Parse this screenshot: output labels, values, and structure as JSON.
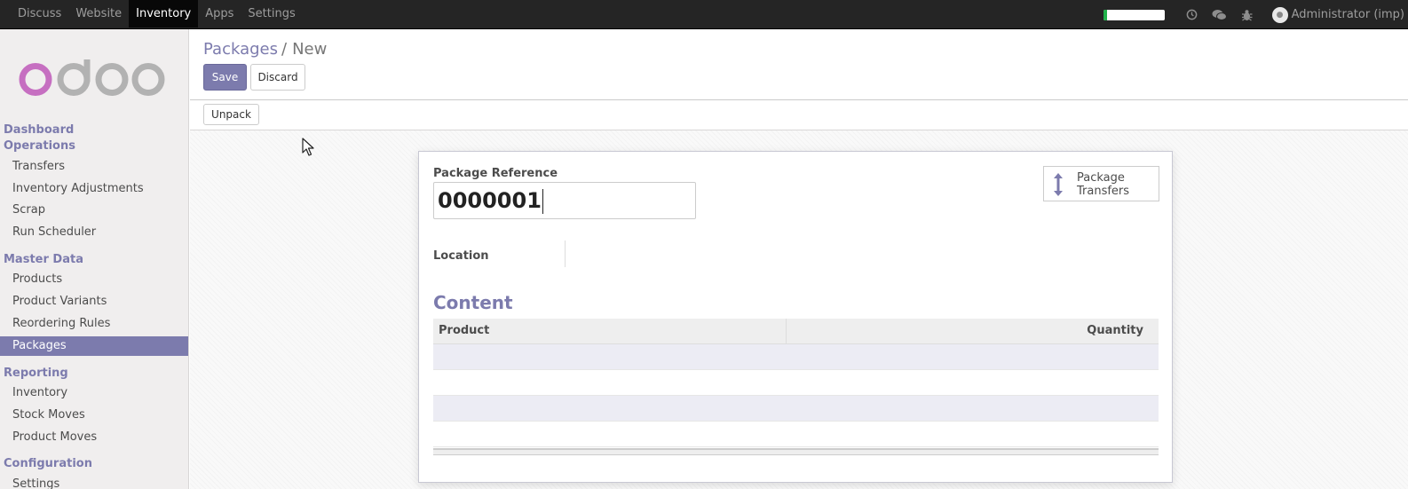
{
  "topbar": {
    "menu": [
      {
        "label": "Discuss",
        "active": false
      },
      {
        "label": "Website",
        "active": false
      },
      {
        "label": "Inventory",
        "active": true
      },
      {
        "label": "Apps",
        "active": false
      },
      {
        "label": "Settings",
        "active": false
      }
    ],
    "progress_fraction": 0.06,
    "progress_color": "#21b24b",
    "icons": [
      "clock-icon",
      "chat-icon",
      "bug-icon"
    ],
    "user": "Administrator (imp)"
  },
  "sidebar": {
    "logo_text": "odoo",
    "sections": [
      {
        "title": "Dashboard",
        "items": []
      },
      {
        "title": "Operations",
        "items": [
          "Transfers",
          "Inventory Adjustments",
          "Scrap",
          "Run Scheduler"
        ]
      },
      {
        "title": "Master Data",
        "items": [
          "Products",
          "Product Variants",
          "Reordering Rules",
          "Packages"
        ]
      },
      {
        "title": "Reporting",
        "items": [
          "Inventory",
          "Stock Moves",
          "Product Moves"
        ]
      },
      {
        "title": "Configuration",
        "items": [
          "Settings"
        ]
      }
    ],
    "active_item": "Packages"
  },
  "control_panel": {
    "breadcrumb": {
      "parent": "Packages",
      "separator": "/",
      "current": "New"
    },
    "save_label": "Save",
    "discard_label": "Discard"
  },
  "statusbar": {
    "unpack_label": "Unpack"
  },
  "form": {
    "package_reference_label": "Package Reference",
    "package_reference_value": "0000001",
    "smart_button_line1": "Package",
    "smart_button_line2": "Transfers",
    "location_label": "Location",
    "location_value": "",
    "content_title": "Content",
    "table": {
      "columns": [
        "Product",
        "Quantity"
      ],
      "rows": [
        [
          "",
          ""
        ],
        [
          "",
          ""
        ],
        [
          "",
          ""
        ],
        [
          "",
          ""
        ]
      ]
    }
  },
  "colors": {
    "accent": "#7c7bad",
    "navbar": "#252525"
  }
}
